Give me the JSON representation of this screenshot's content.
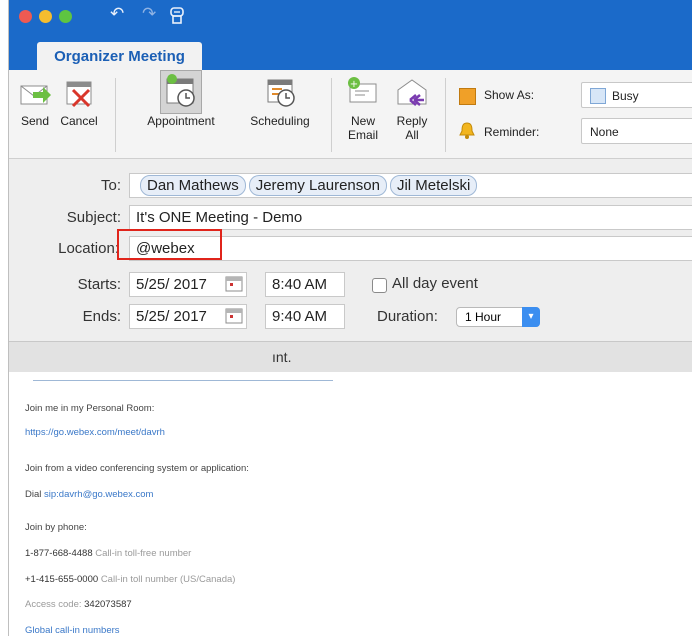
{
  "titlebar": {
    "undo_icon": "undo-icon",
    "redo_icon": "redo-icon",
    "custom_icon": "customize-toolbar-icon"
  },
  "ribbon_tab": {
    "label": "Organizer Meeting"
  },
  "ribbon": {
    "send": {
      "label": "Send"
    },
    "cancel": {
      "label": "Cancel"
    },
    "appointment": {
      "label": "Appointment"
    },
    "scheduling": {
      "label": "Scheduling"
    },
    "new_email": {
      "label_line1": "New",
      "label_line2": "Email"
    },
    "reply_all": {
      "label_line1": "Reply",
      "label_line2": "All"
    },
    "show_as": {
      "label": "Show As:",
      "value": "Busy"
    },
    "reminder": {
      "label": "Reminder:",
      "value": "None"
    }
  },
  "form": {
    "to_label": "To:",
    "recipients": [
      "Dan Mathews",
      "Jeremy Laurenson",
      "Jil Metelski"
    ],
    "subject_label": "Subject:",
    "subject_value": "It's ONE Meeting - Demo",
    "location_label": "Location:",
    "location_value": "@webex",
    "starts_label": "Starts:",
    "start_date": "5/25/ 2017",
    "start_time": "8:40 AM",
    "ends_label": "Ends:",
    "end_date": "5/25/ 2017",
    "end_time": "9:40 AM",
    "all_day_label": "All day event",
    "duration_label": "Duration:",
    "duration_value": "1 Hour"
  },
  "infobar": {
    "text": "ınt."
  },
  "body": {
    "line1": "Join me in my Personal Room:",
    "link1": "https://go.webex.com/meet/davrh",
    "line2": "Join from a video conferencing system or application:",
    "dial_prefix": "Dial",
    "dial_link": "sip:davrh@go.webex.com",
    "line3": "Join by phone:",
    "phone1_num": "1-877-668-4488",
    "phone1_desc": "Call-in toll-free number",
    "phone2_num": "+1-415-655-0000",
    "phone2_desc": "Call-in toll number (US/Canada)",
    "access_label": "Access code:",
    "access_code": "342073587",
    "global_link": "Global call-in numbers"
  },
  "colors": {
    "titlebar": "#1b6ac9",
    "highlight": "#e0241b",
    "link": "#3a78c8"
  }
}
